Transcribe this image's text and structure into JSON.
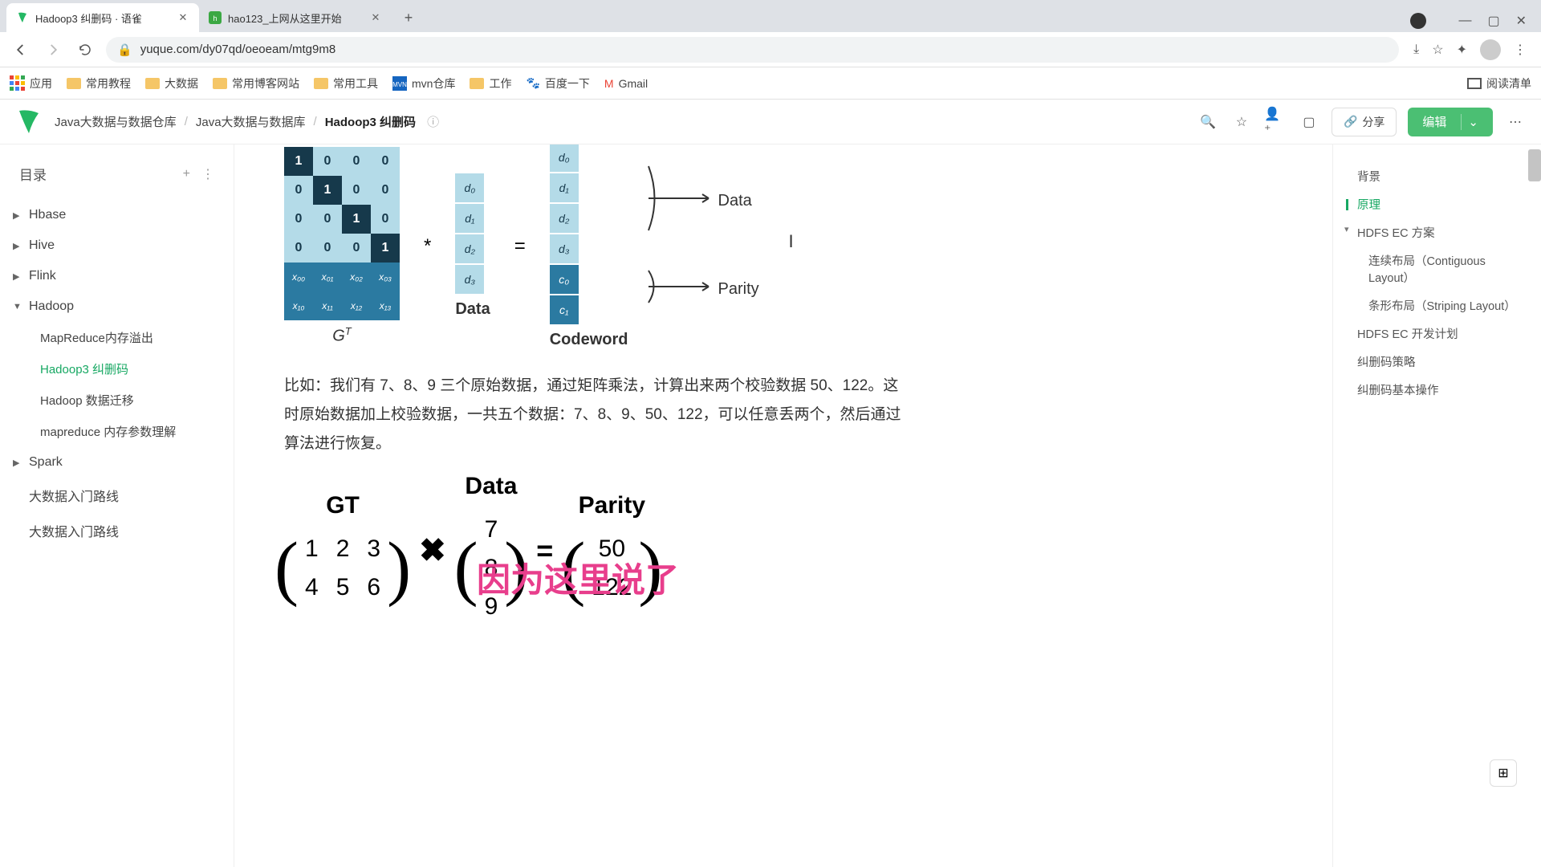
{
  "browser": {
    "tabs": [
      {
        "title": "Hadoop3 纠删码 · 语雀",
        "active": true
      },
      {
        "title": "hao123_上网从这里开始",
        "active": false
      }
    ],
    "url": "yuque.com/dy07qd/oeoeam/mtg9m8",
    "bookmarks": [
      "应用",
      "常用教程",
      "大数据",
      "常用博客网站",
      "常用工具",
      "mvn仓库",
      "工作",
      "百度一下",
      "Gmail"
    ],
    "reading_list": "阅读清单"
  },
  "header": {
    "crumbs": [
      "Java大数据与数据仓库",
      "Java大数据与数据库",
      "Hadoop3 纠删码"
    ],
    "share": "分享",
    "edit": "编辑"
  },
  "toc": {
    "title": "目录",
    "items": [
      {
        "label": "Hbase",
        "expanded": false
      },
      {
        "label": "Hive",
        "expanded": false
      },
      {
        "label": "Flink",
        "expanded": false
      },
      {
        "label": "Hadoop",
        "expanded": true,
        "children": [
          {
            "label": "MapReduce内存溢出"
          },
          {
            "label": "Hadoop3 纠删码",
            "active": true
          },
          {
            "label": "Hadoop 数据迁移"
          },
          {
            "label": "mapreduce 内存参数理解"
          }
        ]
      },
      {
        "label": "Spark",
        "expanded": false
      },
      {
        "label": "大数据入门路线"
      },
      {
        "label": "大数据入门路线"
      }
    ]
  },
  "article": {
    "paragraph": "比如：我们有 7、8、9 三个原始数据，通过矩阵乘法，计算出来两个校验数据 50、122。这时原始数据加上校验数据，一共五个数据：7、8、9、50、122，可以任意丢两个，然后通过算法进行恢复。",
    "overlay": "因为这里说了",
    "diagram1": {
      "gt_label": "G",
      "data_label": "Data",
      "codeword_label": "Codeword",
      "out_data": "Data",
      "out_parity": "Parity",
      "identity": [
        [
          1,
          0,
          0,
          0
        ],
        [
          0,
          1,
          0,
          0
        ],
        [
          0,
          0,
          1,
          0
        ],
        [
          0,
          0,
          0,
          1
        ]
      ],
      "x_rows": [
        [
          "x₀₀",
          "x₀₁",
          "x₀₂",
          "x₀₃"
        ],
        [
          "x₁₀",
          "x₁₁",
          "x₁₂",
          "x₁₃"
        ]
      ],
      "data_vec": [
        "d₀",
        "d₁",
        "d₂",
        "d₃"
      ],
      "codeword_d": [
        "d₀",
        "d₁",
        "d₂",
        "d₃"
      ],
      "codeword_c": [
        "c₀",
        "c₁"
      ]
    },
    "diagram2": {
      "titles": {
        "gt": "GT",
        "data": "Data",
        "parity": "Parity"
      },
      "gt": [
        [
          "1",
          "2",
          "3"
        ],
        [
          "4",
          "5",
          "6"
        ]
      ],
      "data": [
        "7",
        "8",
        "9"
      ],
      "parity": [
        "50",
        "122"
      ]
    }
  },
  "rtoc": [
    "背景",
    "原理",
    "HDFS EC 方案",
    "连续布局（Contiguous Layout）",
    "条形布局（Striping Layout）",
    "HDFS EC 开发计划",
    "纠删码策略",
    "纠删码基本操作"
  ]
}
